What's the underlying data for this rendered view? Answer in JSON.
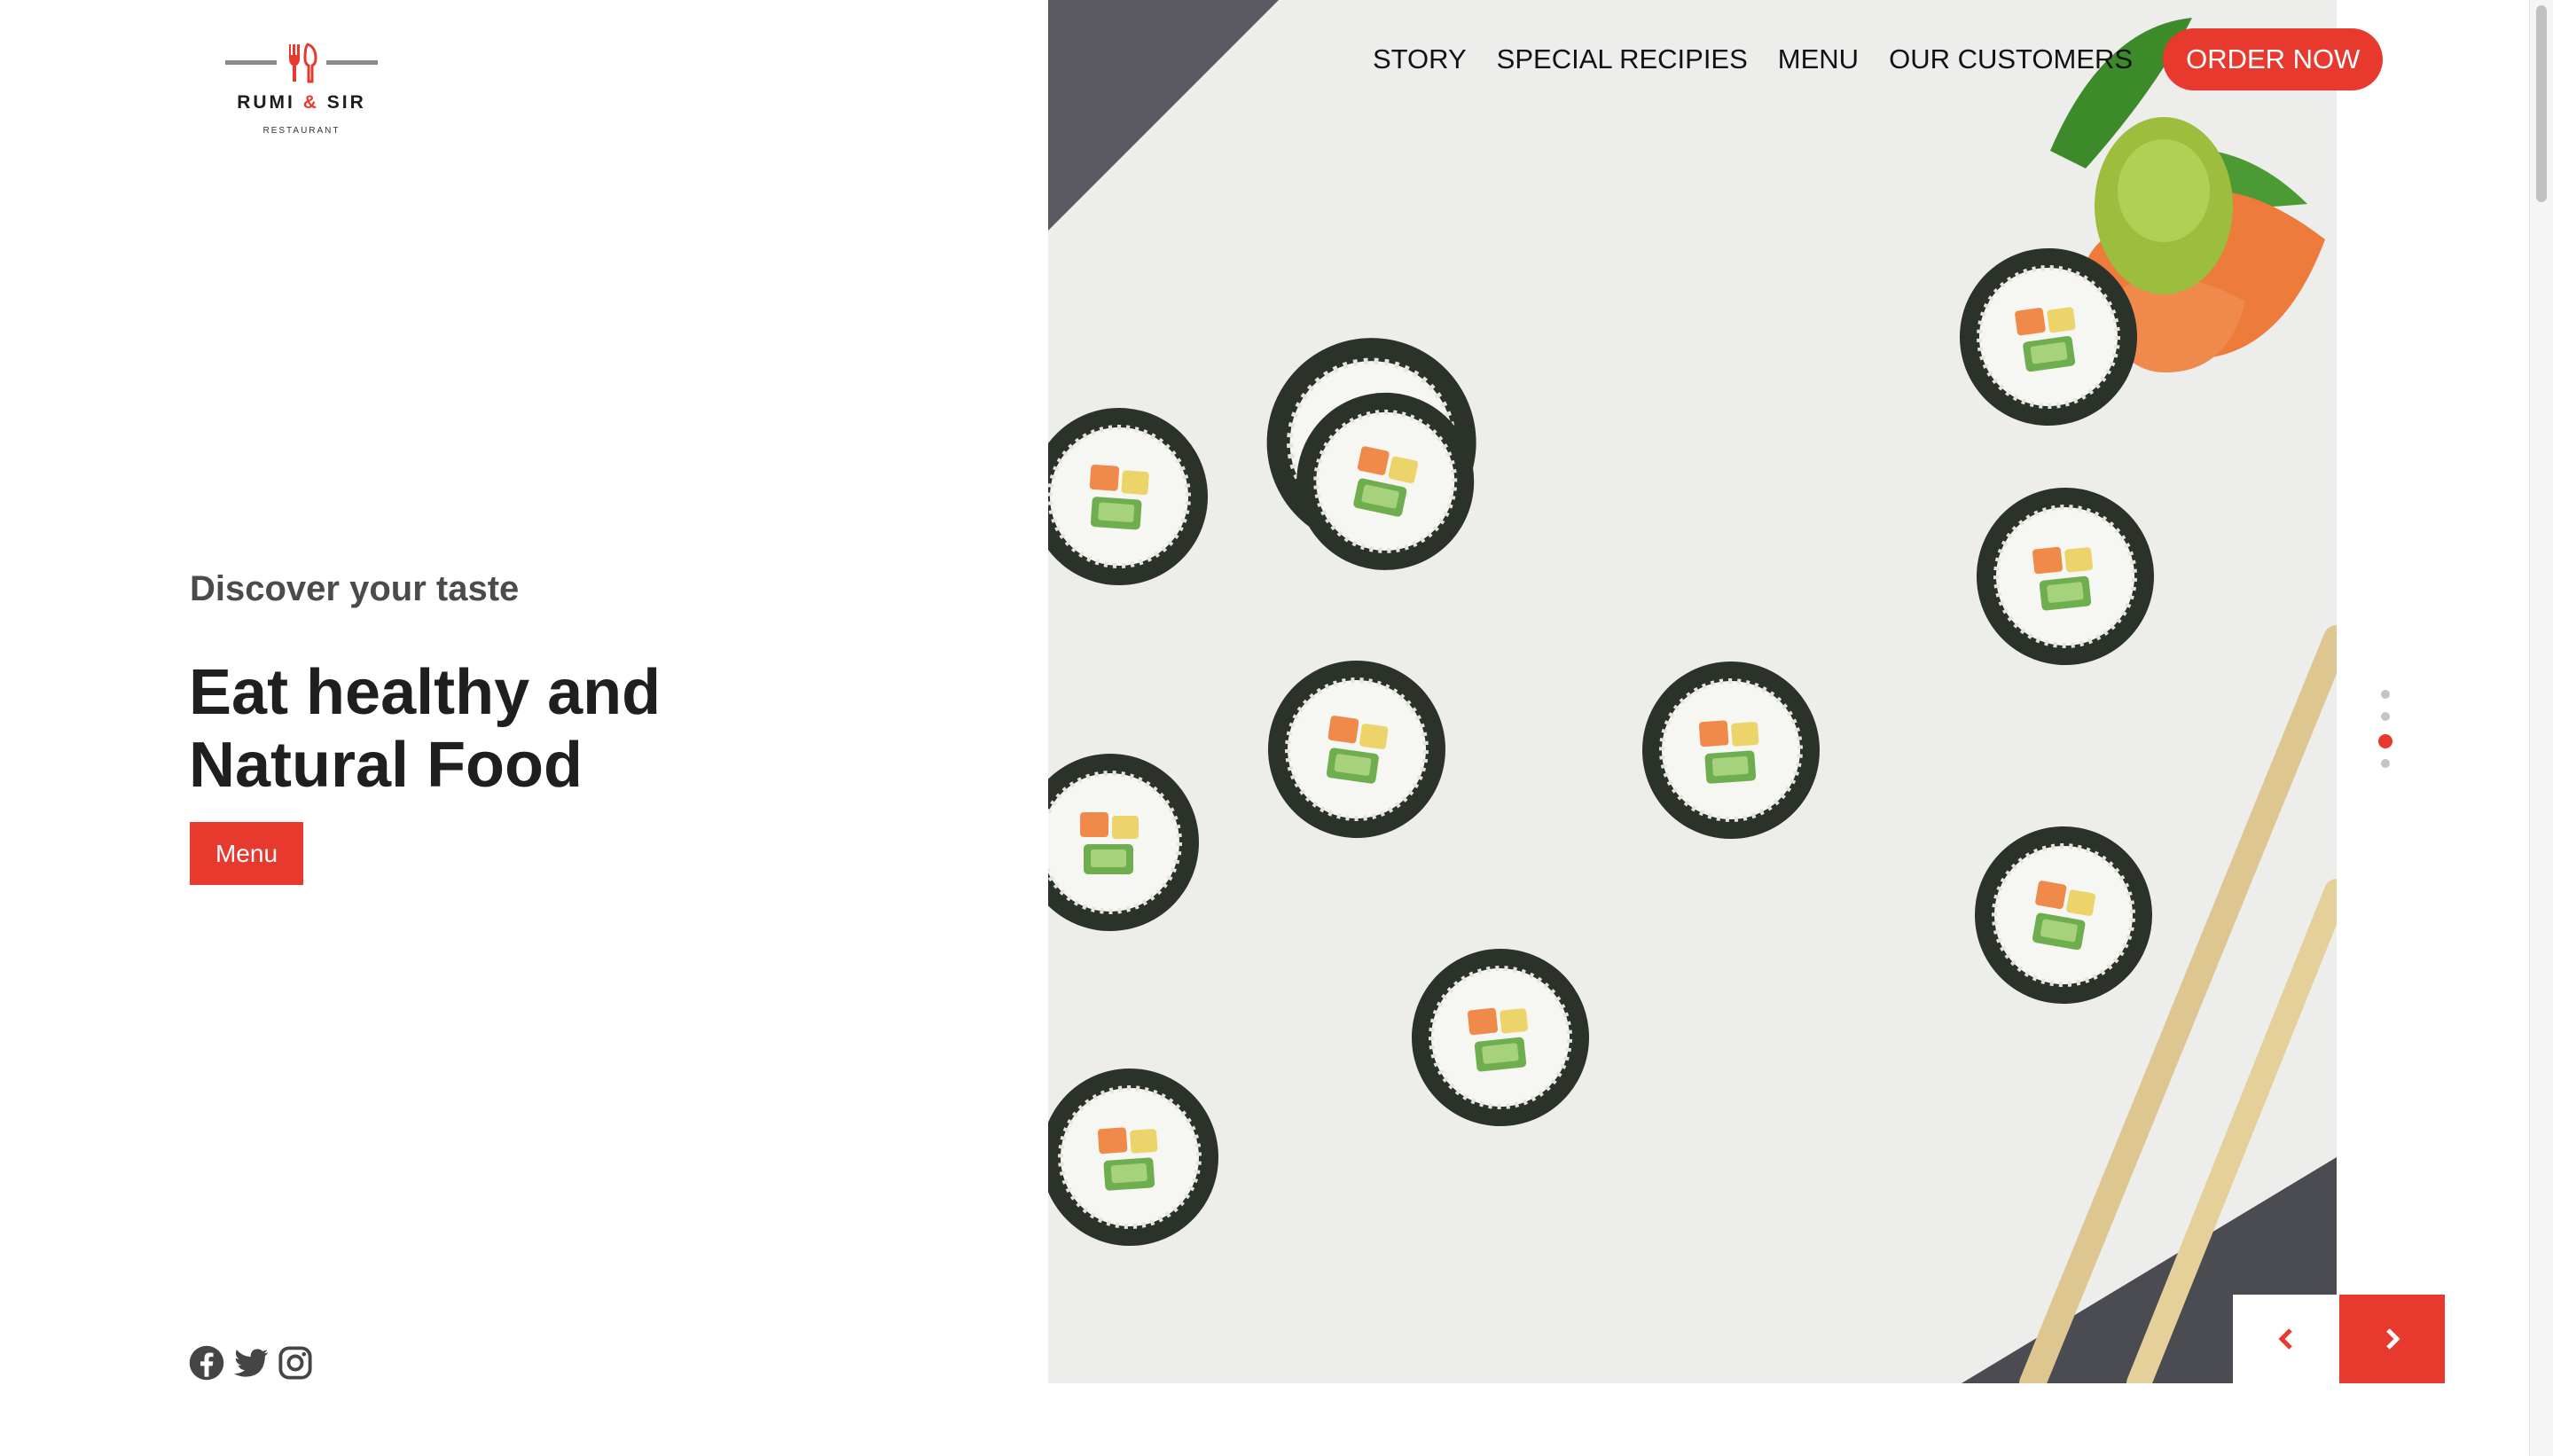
{
  "brand": {
    "name_left": "RUMI",
    "ampersand": "&",
    "name_right": "SIR",
    "subtitle": "RESTAURANT",
    "logo_icon": "fork-and-knife-icon",
    "accent_color": "#e8392e"
  },
  "nav": {
    "links": [
      "STORY",
      "SPECIAL RECIPIES",
      "MENU",
      "OUR CUSTOMERS"
    ],
    "cta": "ORDER NOW"
  },
  "hero": {
    "eyebrow": "Discover your taste",
    "headline_line1": "Eat healthy and",
    "headline_line2": "Natural Food",
    "button": "Menu",
    "image": "sushi-rolls-with-chopsticks-photo"
  },
  "socials": [
    "facebook-icon",
    "twitter-icon",
    "instagram-icon"
  ],
  "slider": {
    "slide_count": 4,
    "active_index": 2,
    "prev_icon": "chevron-left-icon",
    "next_icon": "chevron-right-icon"
  }
}
